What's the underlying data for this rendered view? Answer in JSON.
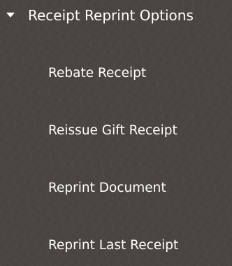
{
  "menu": {
    "header": {
      "label": "Receipt Reprint Options",
      "icon": "caret-down-icon",
      "expanded": true
    },
    "items": [
      {
        "label": "Rebate Receipt"
      },
      {
        "label": "Reissue Gift Receipt"
      },
      {
        "label": "Reprint Document"
      },
      {
        "label": "Reprint Last Receipt"
      }
    ]
  },
  "colors": {
    "background": "#4a4540",
    "text": "#ffffff"
  }
}
